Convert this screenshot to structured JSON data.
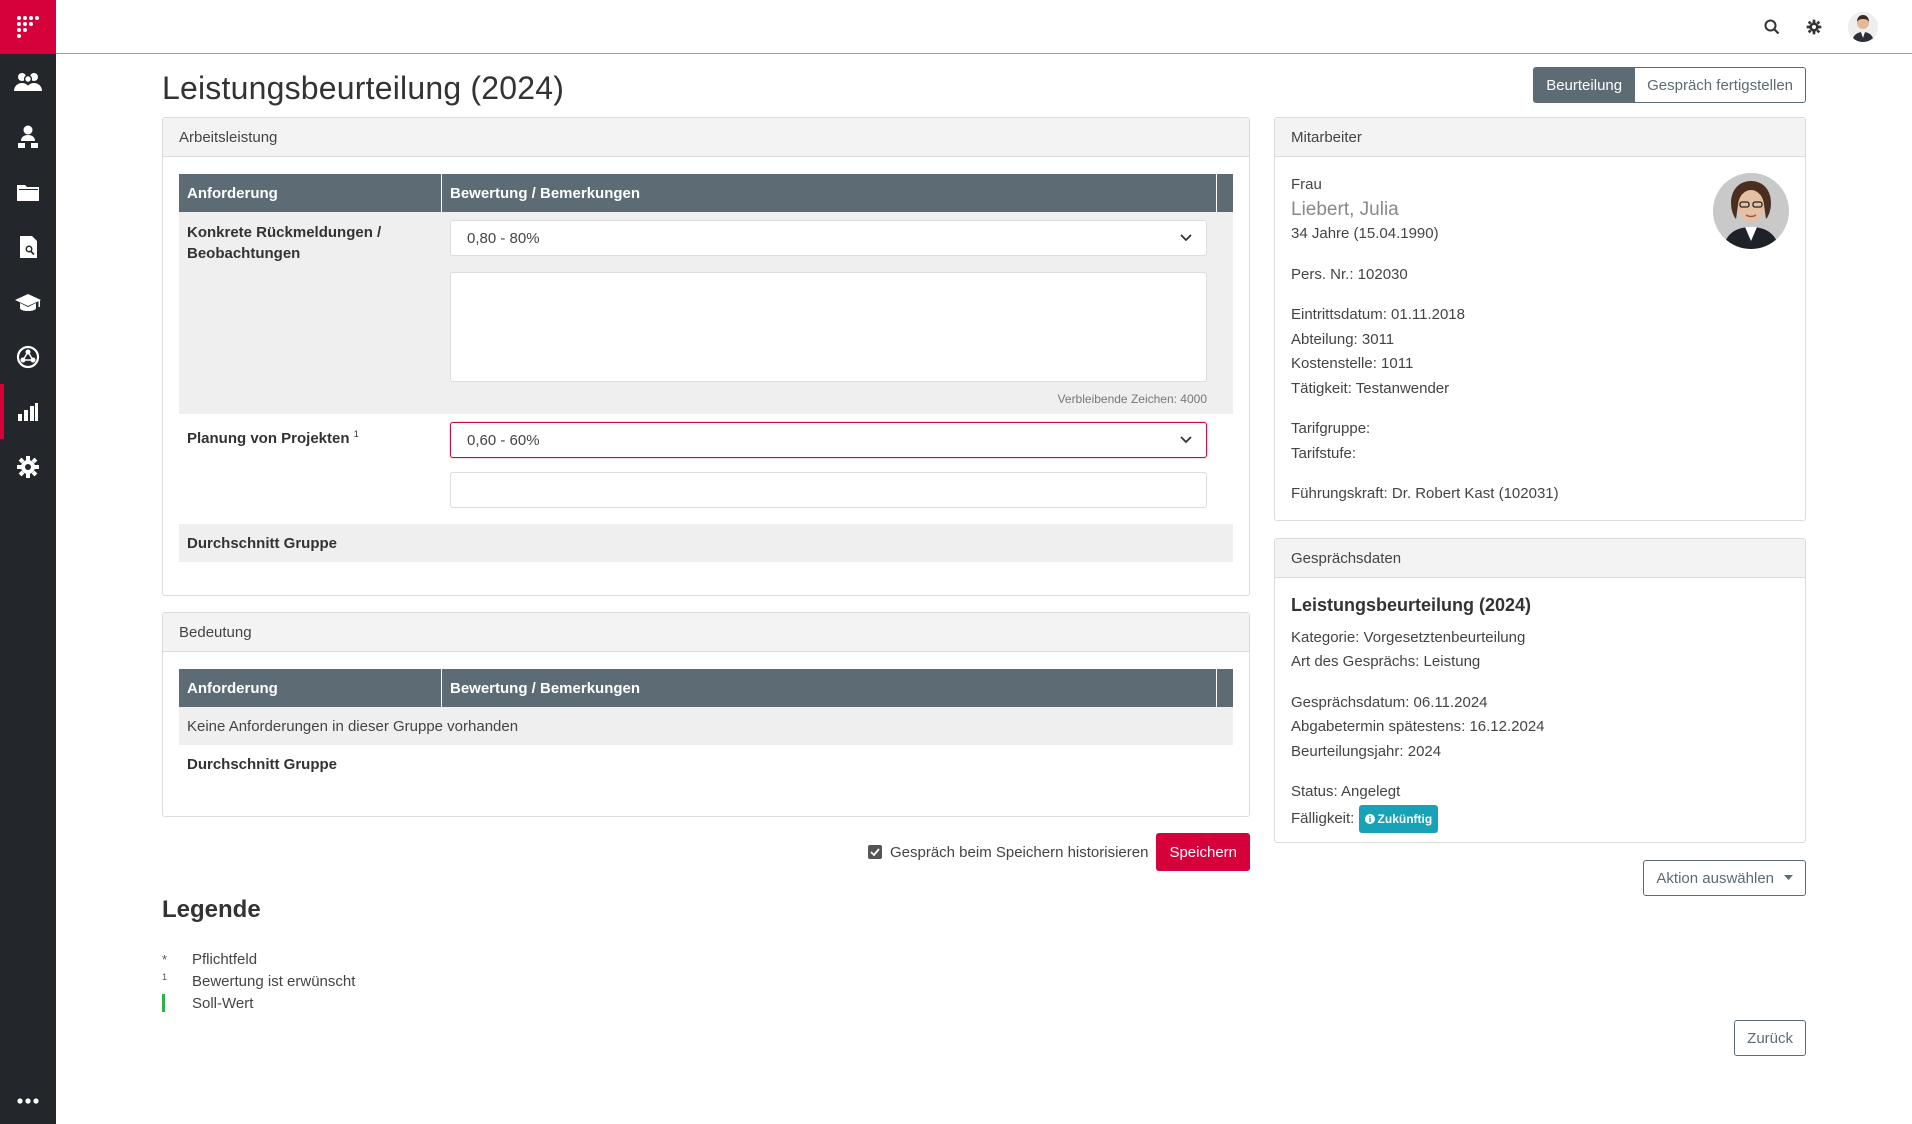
{
  "page": {
    "title": "Leistungsbeurteilung (2024)",
    "tabs": [
      "Beurteilung",
      "Gespräch fertigstellen"
    ]
  },
  "topbar": {
    "icons": [
      "search-icon",
      "gear-icon",
      "user-avatar"
    ]
  },
  "sidebar": {
    "items": [
      "people-icon",
      "org-icon",
      "folder-icon",
      "document-search-icon",
      "graduation-icon",
      "network-icon",
      "chart-icon",
      "settings-icon"
    ],
    "active_index": 6,
    "more": "more-icon"
  },
  "arbeitsleistung": {
    "title": "Arbeitsleistung",
    "col_requirement": "Anforderung",
    "col_rating": "Bewertung / Bemerkungen",
    "rows": [
      {
        "label": "Konkrete Rückmeldungen / Beobachtungen",
        "marker": "",
        "value": "0,80 - 80%",
        "remaining": "Verbleibende Zeichen: 4000"
      },
      {
        "label": "Planung von Projekten",
        "marker": "1",
        "value": "0,60 - 60%"
      }
    ],
    "avg_label": "Durchschnitt Gruppe"
  },
  "bedeutung": {
    "title": "Bedeutung",
    "col_requirement": "Anforderung",
    "col_rating": "Bewertung / Bemerkungen",
    "empty": "Keine Anforderungen in dieser Gruppe vorhanden",
    "avg_label": "Durchschnitt Gruppe"
  },
  "mitarbeiter": {
    "title": "Mitarbeiter",
    "salutation": "Frau",
    "name": "Liebert, Julia",
    "age": "34 Jahre (15.04.1990)",
    "pers_nr": "Pers. Nr.: 102030",
    "eintritt": "Eintrittsdatum: 01.11.2018",
    "abteilung": "Abteilung: 3011",
    "kostenstelle": "Kostenstelle: 1011",
    "taetigkeit": "Tätigkeit: Testanwender",
    "tarifgruppe": "Tarifgruppe:",
    "tarifstufe": "Tarifstufe:",
    "fuehrung": "Führungskraft: Dr. Robert Kast (102031)"
  },
  "gespraech": {
    "title": "Gesprächsdaten",
    "heading": "Leistungsbeurteilung (2024)",
    "kategorie": "Kategorie: Vorgesetztenbeurteilung",
    "art": "Art des Gesprächs: Leistung",
    "datum": "Gesprächsdatum: 06.11.2024",
    "abgabe": "Abgabetermin spätestens: 16.12.2024",
    "jahr": "Beurteilungsjahr: 2024",
    "status": "Status: Angelegt",
    "faelligkeit_label": "Fälligkeit:",
    "faelligkeit_badge": "Zukünftig"
  },
  "actions": {
    "history_label": "Gespräch beim Speichern historisieren",
    "history_checked": true,
    "save": "Speichern",
    "action_select": "Aktion auswählen",
    "back": "Zurück"
  },
  "legend": {
    "title": "Legende",
    "items": [
      {
        "symbol": "*",
        "text": "Pflichtfeld"
      },
      {
        "symbol": "1",
        "text": "Bewertung ist erwünscht"
      },
      {
        "symbol": "",
        "text": "Soll-Wert"
      }
    ]
  },
  "colors": {
    "brand": "#d6003a",
    "sidebar": "#23272b",
    "table_head": "#5d6b74",
    "badge": "#17a2b8",
    "target_value": "#2bb34a"
  }
}
